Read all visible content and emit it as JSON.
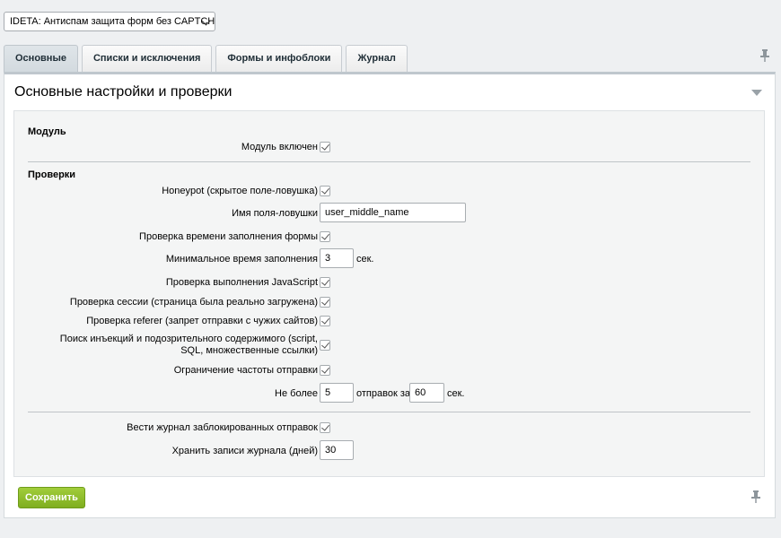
{
  "module_select": {
    "value": "IDETA: Антиспам защита форм без CAPTCHA"
  },
  "tabs": [
    {
      "label": "Основные",
      "active": true
    },
    {
      "label": "Списки и исключения",
      "active": false
    },
    {
      "label": "Формы и инфоблоки",
      "active": false
    },
    {
      "label": "Журнал",
      "active": false
    }
  ],
  "panel": {
    "title": "Основные настройки и проверки"
  },
  "sections": {
    "module": "Модуль",
    "checks": "Проверки"
  },
  "settings": {
    "module_enabled": {
      "label": "Модуль включен",
      "checked": true
    },
    "honeypot": {
      "label": "Honeypot (скрытое поле-ловушка)",
      "checked": true
    },
    "trap_field_name": {
      "label": "Имя поля-ловушки",
      "value": "user_middle_name"
    },
    "fill_time_check": {
      "label": "Проверка времени заполнения формы",
      "checked": true
    },
    "min_fill_time": {
      "label": "Минимальное время заполнения",
      "value": "3",
      "unit": "сек."
    },
    "js_check": {
      "label": "Проверка выполнения JavaScript",
      "checked": true
    },
    "session_check": {
      "label": "Проверка сессии (страница была реально загружена)",
      "checked": true
    },
    "referer_check": {
      "label": "Проверка referer (запрет отправки с чужих сайтов)",
      "checked": true
    },
    "injection_check": {
      "label": "Поиск инъекций и подозрительного содержимого (script, SQL, множественные ссылки)",
      "checked": true
    },
    "rate_limit": {
      "label": "Ограничение частоты отправки",
      "checked": true
    },
    "rate_limit_params": {
      "label": "Не более",
      "count": "5",
      "mid_text": "отправок за",
      "seconds": "60",
      "unit": "сек."
    },
    "log_blocked": {
      "label": "Вести журнал заблокированных отправок",
      "checked": true
    },
    "log_retention": {
      "label": "Хранить записи журнала (дней)",
      "value": "30"
    }
  },
  "actions": {
    "save_label": "Сохранить"
  },
  "icons": {
    "pin": "pin-icon",
    "collapse": "collapse-arrow-icon",
    "select": "chevron-down-icon",
    "checkbox": "checkmark-icon"
  },
  "colors": {
    "save_button": "#8ab92d",
    "active_tab": "#d8dfe3"
  }
}
